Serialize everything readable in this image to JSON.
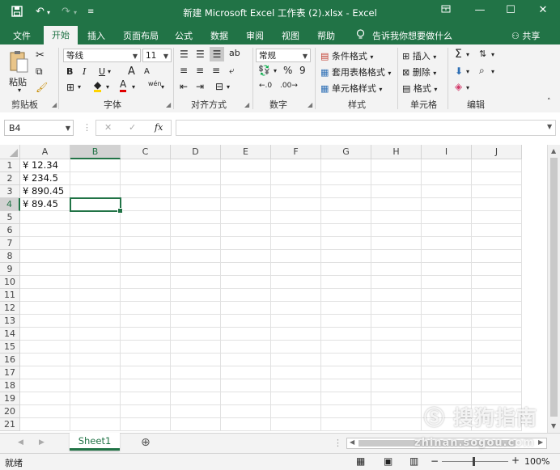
{
  "window": {
    "title": "新建 Microsoft Excel 工作表 (2).xlsx  -  Excel",
    "buttons": [
      "minimize",
      "maximize",
      "close"
    ]
  },
  "tabs": [
    {
      "label": "文件",
      "active": false
    },
    {
      "label": "开始",
      "active": true
    },
    {
      "label": "插入",
      "active": false
    },
    {
      "label": "页面布局",
      "active": false
    },
    {
      "label": "公式",
      "active": false
    },
    {
      "label": "数据",
      "active": false
    },
    {
      "label": "审阅",
      "active": false
    },
    {
      "label": "视图",
      "active": false
    },
    {
      "label": "帮助",
      "active": false
    }
  ],
  "tell_me": "告诉我你想要做什么",
  "share": "共享",
  "ribbon": {
    "clipboard": {
      "paste": "粘贴",
      "label": "剪贴板"
    },
    "font": {
      "name": "等线",
      "size": "11",
      "label": "字体",
      "bold": "B",
      "italic": "I",
      "underline": "U",
      "grow": "A",
      "shrink": "A",
      "font_color_glyph": "A",
      "phonetic": "wén"
    },
    "alignment": {
      "label": "对齐方式"
    },
    "number": {
      "format": "常规",
      "label": "数字",
      "percent": "%",
      "comma": "9"
    },
    "styles": {
      "conditional": "条件格式",
      "table": "套用表格格式",
      "cell_styles": "单元格样式",
      "label": "样式"
    },
    "cells": {
      "insert": "插入",
      "delete": "删除",
      "format": "格式",
      "label": "单元格"
    },
    "editing": {
      "label": "编辑"
    }
  },
  "formula_bar": {
    "name_box": "B4",
    "formula": "",
    "fx": "fx"
  },
  "columns": [
    "A",
    "B",
    "C",
    "D",
    "E",
    "F",
    "G",
    "H",
    "I",
    "J"
  ],
  "rows": [
    "1",
    "2",
    "3",
    "4",
    "5",
    "6",
    "7",
    "8",
    "9",
    "10",
    "11",
    "12",
    "13",
    "14",
    "15",
    "16",
    "17",
    "18",
    "19",
    "20",
    "21"
  ],
  "cells": {
    "A1": "¥ 12.34",
    "A2": "¥ 234.5",
    "A3": "¥ 890.45",
    "A4": "¥ 89.45"
  },
  "active_cell": "B4",
  "sheets": [
    {
      "name": "Sheet1",
      "active": true
    }
  ],
  "status": {
    "ready": "就绪",
    "zoom": "100%"
  },
  "watermark": {
    "brand": "搜狗指南",
    "url": "zhinan.sogou.com"
  },
  "colors": {
    "accent": "#217346",
    "ribbon_bg": "#f3f3f3"
  }
}
